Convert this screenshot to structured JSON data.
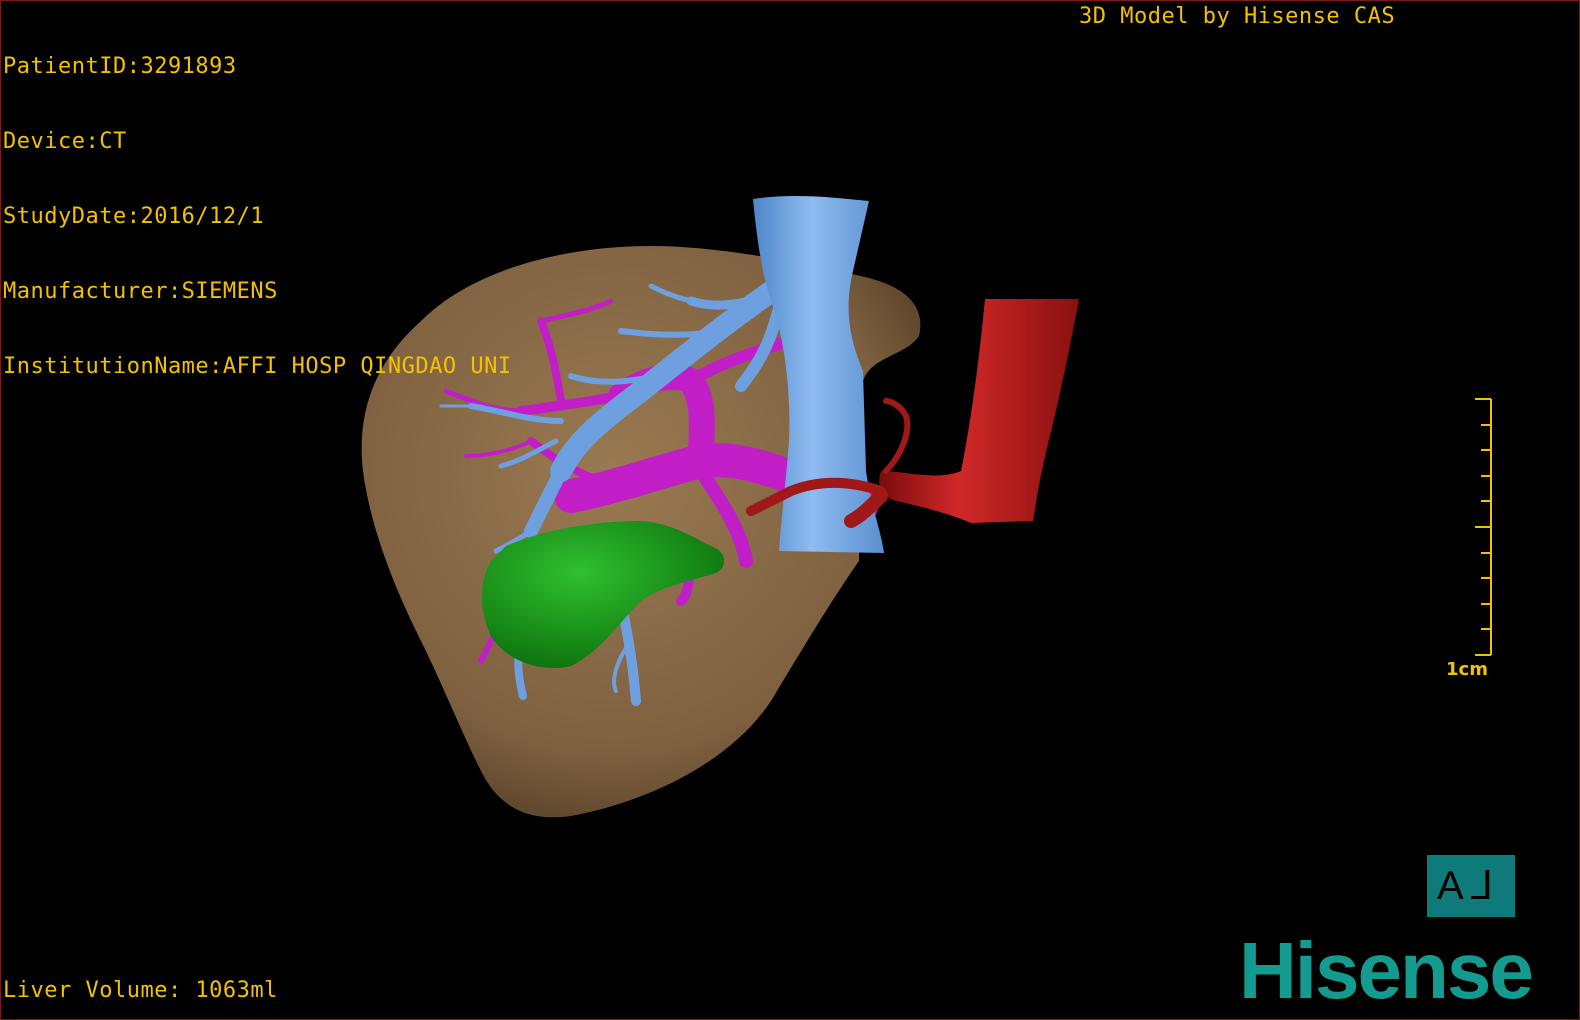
{
  "overlay": {
    "patient_id": "PatientID:3291893",
    "device": "Device:CT",
    "study_date": "StudyDate:2016/12/1",
    "manufacturer": "Manufacturer:SIEMENS",
    "institution": "InstitutionName:AFFI HOSP QINGDAO UNI",
    "model_credit": "3D Model by Hisense CAS",
    "liver_volume": "Liver Volume: 1063ml"
  },
  "scale": {
    "label": "1cm"
  },
  "orientation_cube": {
    "face_label_a": "A",
    "face_label_r": "⅃"
  },
  "brand": {
    "logo_text": "Hisense"
  },
  "model": {
    "structures": [
      {
        "name": "liver",
        "color": "#8a6a44"
      },
      {
        "name": "hepatic-veins",
        "color": "#6ea0e0"
      },
      {
        "name": "portal-vein",
        "color": "#c21ec8"
      },
      {
        "name": "tumor",
        "color": "#1a9a1a"
      },
      {
        "name": "aorta",
        "color": "#b01818"
      }
    ]
  },
  "colors": {
    "overlay_text": "#f2c200",
    "brand": "#149b8f",
    "cube": "#0f7a7a"
  }
}
